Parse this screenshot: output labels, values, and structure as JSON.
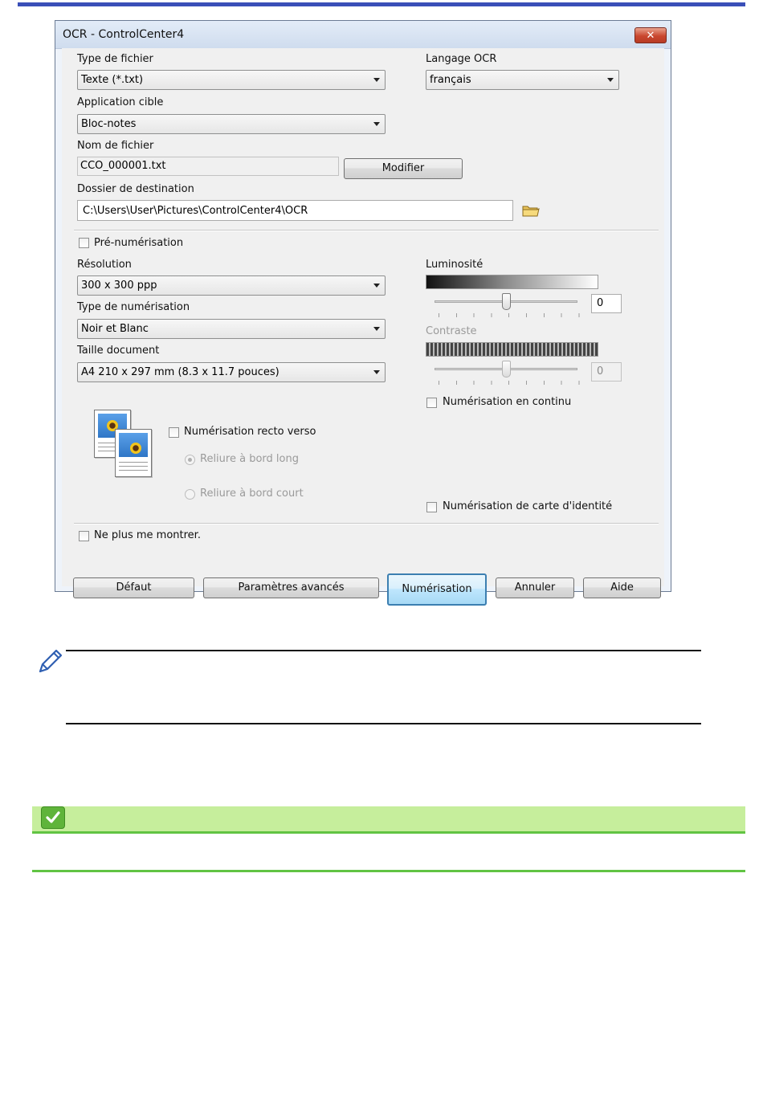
{
  "dialog": {
    "title": "OCR - ControlCenter4",
    "close_symbol": "✕",
    "file_type": {
      "label": "Type de fichier",
      "value": "Texte (*.txt)"
    },
    "ocr_language": {
      "label": "Langage OCR",
      "value": "français"
    },
    "target_app": {
      "label": "Application cible",
      "value": "Bloc-notes"
    },
    "file_name": {
      "label": "Nom de fichier",
      "value": "CCO_000001.txt",
      "modify_button": "Modifier"
    },
    "destination": {
      "label": "Dossier de destination",
      "value": "C:\\Users\\User\\Pictures\\ControlCenter4\\OCR",
      "icon": "folder-icon"
    },
    "prescan": {
      "label": "Pré-numérisation",
      "checked": false
    },
    "resolution": {
      "label": "Résolution",
      "value": "300 x 300 ppp"
    },
    "scan_type": {
      "label": "Type de numérisation",
      "value": "Noir et Blanc"
    },
    "doc_size": {
      "label": "Taille document",
      "value": "A4 210 x 297 mm (8.3 x 11.7 pouces)"
    },
    "brightness": {
      "label": "Luminosité",
      "value": "0",
      "level": 0.5
    },
    "contrast": {
      "label": "Contraste",
      "value": "0",
      "level": 0.5,
      "enabled": false
    },
    "continuous": {
      "label": "Numérisation en continu",
      "checked": false
    },
    "duplex": {
      "label": "Numérisation recto verso",
      "checked": false,
      "long_edge": "Reliure à bord long",
      "short_edge": "Reliure à bord court"
    },
    "id_card": {
      "label": "Numérisation de carte d'identité",
      "checked": false
    },
    "dont_show": {
      "label": "Ne plus me montrer.",
      "checked": false
    },
    "buttons": {
      "default": "Défaut",
      "advanced": "Paramètres avancés",
      "scan": "Numérisation",
      "cancel": "Annuler",
      "help": "Aide"
    }
  },
  "note": {
    "icon": "pencil-icon"
  },
  "related": {
    "icon": "checkmark-icon",
    "accent": "#61c443"
  },
  "colors": {
    "top_bar": "#3a4fb8",
    "green_band": "#c6ee9c"
  }
}
